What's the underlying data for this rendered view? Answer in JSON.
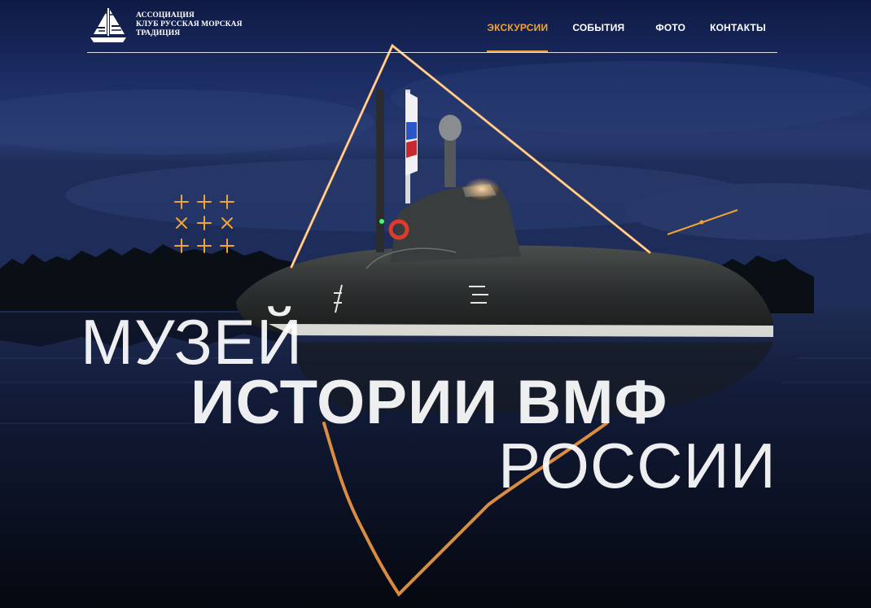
{
  "logo": {
    "line1": "АССОЦИАЦИЯ",
    "line2": "КЛУБ РУССКАЯ МОРСКАЯ",
    "line3": "ТРАДИЦИЯ",
    "icon": "sailboat-icon"
  },
  "nav": {
    "items": [
      {
        "label": "ЭКСКУРСИИ",
        "active": true
      },
      {
        "label": "СОБЫТИЯ",
        "active": false
      },
      {
        "label": "ФОТО",
        "active": false
      },
      {
        "label": "КОНТАКТЫ",
        "active": false
      }
    ]
  },
  "hero": {
    "line1": "МУЗЕЙ",
    "line2": "ИСТОРИИ ВМФ",
    "line3": "РОССИИ"
  },
  "colors": {
    "accent": "#f2a335",
    "sky": "#1c2d62",
    "water": "#0a1020",
    "hull": "#2a2d2d",
    "lights": "#ff9a3a"
  }
}
